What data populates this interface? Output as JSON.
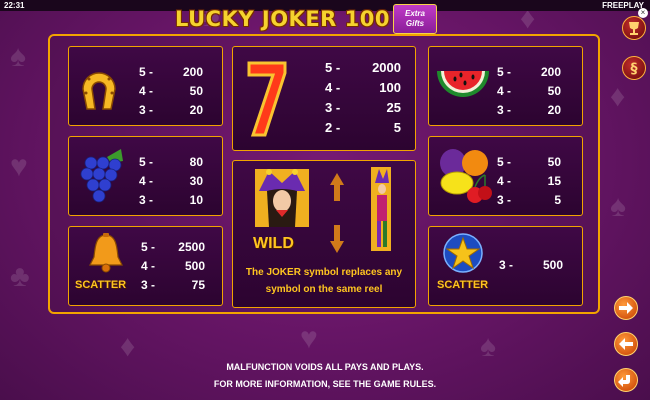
{
  "topbar": {
    "clock": "22:31",
    "mode": "FREEPLAY"
  },
  "logo": {
    "title": "LUCKY JOKER 100",
    "badge_line1": "Extra",
    "badge_line2": "Gifts"
  },
  "paytable": {
    "horseshoe": [
      {
        "n": "5 -",
        "v": "200"
      },
      {
        "n": "4 -",
        "v": "50"
      },
      {
        "n": "3 -",
        "v": "20"
      }
    ],
    "seven": [
      {
        "n": "5 -",
        "v": "2000"
      },
      {
        "n": "4 -",
        "v": "100"
      },
      {
        "n": "3 -",
        "v": "25"
      },
      {
        "n": "2 -",
        "v": "5"
      }
    ],
    "watermelon": [
      {
        "n": "5 -",
        "v": "200"
      },
      {
        "n": "4 -",
        "v": "50"
      },
      {
        "n": "3 -",
        "v": "20"
      }
    ],
    "grapes": [
      {
        "n": "5 -",
        "v": "80"
      },
      {
        "n": "4 -",
        "v": "30"
      },
      {
        "n": "3 -",
        "v": "10"
      }
    ],
    "fruits": [
      {
        "n": "5 -",
        "v": "50"
      },
      {
        "n": "4 -",
        "v": "15"
      },
      {
        "n": "3 -",
        "v": "5"
      }
    ],
    "bell": [
      {
        "n": "5 -",
        "v": "2500"
      },
      {
        "n": "4 -",
        "v": "500"
      },
      {
        "n": "3 -",
        "v": "75"
      }
    ],
    "star": [
      {
        "n": "3 -",
        "v": "500"
      }
    ]
  },
  "labels": {
    "scatter": "SCATTER",
    "wild": "WILD"
  },
  "wild_text": {
    "line1": "The JOKER symbol replaces any",
    "line2": "symbol on the same reel"
  },
  "footer": {
    "line1": "MALFUNCTION VOIDS ALL PAYS AND PLAYS.",
    "line2": "FOR MORE INFORMATION, SEE THE GAME RULES."
  },
  "colors": {
    "accent": "#f2a400",
    "gold_text": "#ffc520",
    "background": "#6a1669"
  }
}
